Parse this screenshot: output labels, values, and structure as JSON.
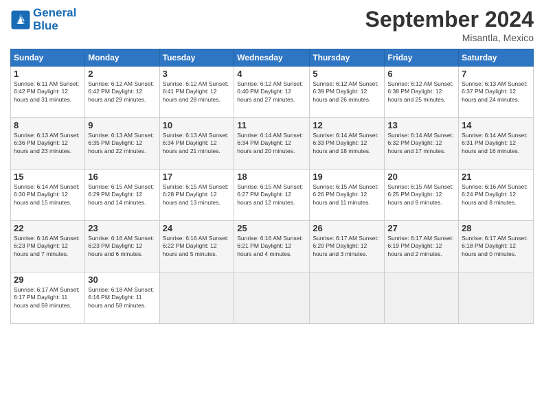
{
  "header": {
    "logo_line1": "General",
    "logo_line2": "Blue",
    "month": "September 2024",
    "location": "Misantla, Mexico"
  },
  "days_of_week": [
    "Sunday",
    "Monday",
    "Tuesday",
    "Wednesday",
    "Thursday",
    "Friday",
    "Saturday"
  ],
  "weeks": [
    [
      {
        "day": "1",
        "detail": "Sunrise: 6:11 AM\nSunset: 6:42 PM\nDaylight: 12 hours\nand 31 minutes."
      },
      {
        "day": "2",
        "detail": "Sunrise: 6:12 AM\nSunset: 6:42 PM\nDaylight: 12 hours\nand 29 minutes."
      },
      {
        "day": "3",
        "detail": "Sunrise: 6:12 AM\nSunset: 6:41 PM\nDaylight: 12 hours\nand 28 minutes."
      },
      {
        "day": "4",
        "detail": "Sunrise: 6:12 AM\nSunset: 6:40 PM\nDaylight: 12 hours\nand 27 minutes."
      },
      {
        "day": "5",
        "detail": "Sunrise: 6:12 AM\nSunset: 6:39 PM\nDaylight: 12 hours\nand 26 minutes."
      },
      {
        "day": "6",
        "detail": "Sunrise: 6:12 AM\nSunset: 6:38 PM\nDaylight: 12 hours\nand 25 minutes."
      },
      {
        "day": "7",
        "detail": "Sunrise: 6:13 AM\nSunset: 6:37 PM\nDaylight: 12 hours\nand 24 minutes."
      }
    ],
    [
      {
        "day": "8",
        "detail": "Sunrise: 6:13 AM\nSunset: 6:36 PM\nDaylight: 12 hours\nand 23 minutes."
      },
      {
        "day": "9",
        "detail": "Sunrise: 6:13 AM\nSunset: 6:35 PM\nDaylight: 12 hours\nand 22 minutes."
      },
      {
        "day": "10",
        "detail": "Sunrise: 6:13 AM\nSunset: 6:34 PM\nDaylight: 12 hours\nand 21 minutes."
      },
      {
        "day": "11",
        "detail": "Sunrise: 6:14 AM\nSunset: 6:34 PM\nDaylight: 12 hours\nand 20 minutes."
      },
      {
        "day": "12",
        "detail": "Sunrise: 6:14 AM\nSunset: 6:33 PM\nDaylight: 12 hours\nand 18 minutes."
      },
      {
        "day": "13",
        "detail": "Sunrise: 6:14 AM\nSunset: 6:32 PM\nDaylight: 12 hours\nand 17 minutes."
      },
      {
        "day": "14",
        "detail": "Sunrise: 6:14 AM\nSunset: 6:31 PM\nDaylight: 12 hours\nand 16 minutes."
      }
    ],
    [
      {
        "day": "15",
        "detail": "Sunrise: 6:14 AM\nSunset: 6:30 PM\nDaylight: 12 hours\nand 15 minutes."
      },
      {
        "day": "16",
        "detail": "Sunrise: 6:15 AM\nSunset: 6:29 PM\nDaylight: 12 hours\nand 14 minutes."
      },
      {
        "day": "17",
        "detail": "Sunrise: 6:15 AM\nSunset: 6:28 PM\nDaylight: 12 hours\nand 13 minutes."
      },
      {
        "day": "18",
        "detail": "Sunrise: 6:15 AM\nSunset: 6:27 PM\nDaylight: 12 hours\nand 12 minutes."
      },
      {
        "day": "19",
        "detail": "Sunrise: 6:15 AM\nSunset: 6:26 PM\nDaylight: 12 hours\nand 11 minutes."
      },
      {
        "day": "20",
        "detail": "Sunrise: 6:15 AM\nSunset: 6:25 PM\nDaylight: 12 hours\nand 9 minutes."
      },
      {
        "day": "21",
        "detail": "Sunrise: 6:16 AM\nSunset: 6:24 PM\nDaylight: 12 hours\nand 8 minutes."
      }
    ],
    [
      {
        "day": "22",
        "detail": "Sunrise: 6:16 AM\nSunset: 6:23 PM\nDaylight: 12 hours\nand 7 minutes."
      },
      {
        "day": "23",
        "detail": "Sunrise: 6:16 AM\nSunset: 6:23 PM\nDaylight: 12 hours\nand 6 minutes."
      },
      {
        "day": "24",
        "detail": "Sunrise: 6:16 AM\nSunset: 6:22 PM\nDaylight: 12 hours\nand 5 minutes."
      },
      {
        "day": "25",
        "detail": "Sunrise: 6:16 AM\nSunset: 6:21 PM\nDaylight: 12 hours\nand 4 minutes."
      },
      {
        "day": "26",
        "detail": "Sunrise: 6:17 AM\nSunset: 6:20 PM\nDaylight: 12 hours\nand 3 minutes."
      },
      {
        "day": "27",
        "detail": "Sunrise: 6:17 AM\nSunset: 6:19 PM\nDaylight: 12 hours\nand 2 minutes."
      },
      {
        "day": "28",
        "detail": "Sunrise: 6:17 AM\nSunset: 6:18 PM\nDaylight: 12 hours\nand 0 minutes."
      }
    ],
    [
      {
        "day": "29",
        "detail": "Sunrise: 6:17 AM\nSunset: 6:17 PM\nDaylight: 11 hours\nand 59 minutes."
      },
      {
        "day": "30",
        "detail": "Sunrise: 6:18 AM\nSunset: 6:16 PM\nDaylight: 11 hours\nand 58 minutes."
      },
      {
        "day": "",
        "detail": ""
      },
      {
        "day": "",
        "detail": ""
      },
      {
        "day": "",
        "detail": ""
      },
      {
        "day": "",
        "detail": ""
      },
      {
        "day": "",
        "detail": ""
      }
    ]
  ]
}
